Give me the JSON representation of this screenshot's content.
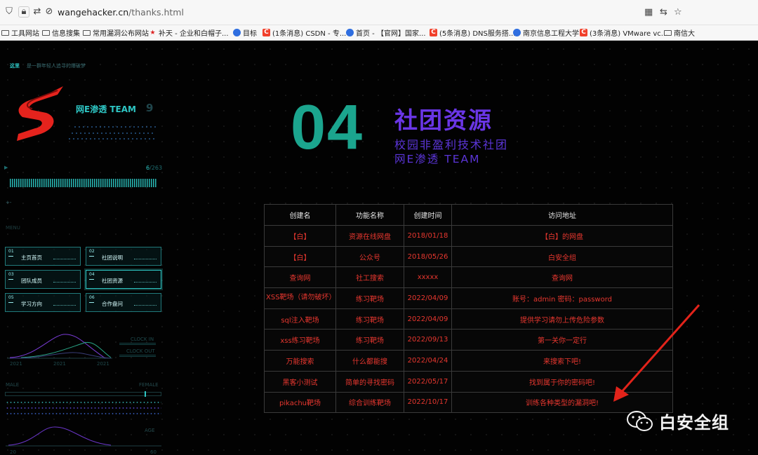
{
  "browser": {
    "url_domain": "wangehacker.cn",
    "url_path": "/thanks.html",
    "bookmarks": [
      {
        "label": "工具网站",
        "icon": "folder-icon"
      },
      {
        "label": "信息搜集",
        "icon": "folder-icon"
      },
      {
        "label": "常用漏洞公布网站",
        "icon": "folder-icon"
      },
      {
        "label": "补天 - 企业和白帽子...",
        "icon": "star-icon"
      },
      {
        "label": "目标",
        "icon": "globe-icon"
      },
      {
        "label": "(1条消息) CSDN - 专...",
        "icon": "csdn-icon"
      },
      {
        "label": "首页 - 【官网】国家...",
        "icon": "globe-icon"
      },
      {
        "label": "(5条消息) DNS服务搭...",
        "icon": "csdn-icon"
      },
      {
        "label": "南京信息工程大学",
        "icon": "globe-icon"
      },
      {
        "label": "(3条消息) VMware vc...",
        "icon": "csdn-icon"
      },
      {
        "label": "南信大",
        "icon": "folder-icon"
      }
    ]
  },
  "sidebar": {
    "top_here": "这里",
    "top_tagline": "是一群年轻人追寻的爆破梦",
    "brand_name": "网E渗透 TEAM",
    "brand_num": "9",
    "counter_current": "6",
    "counter_total": "/263",
    "menu_label": "MENU",
    "menu": [
      {
        "num": "01",
        "label": "主页首页"
      },
      {
        "num": "02",
        "label": "社团说明"
      },
      {
        "num": "03",
        "label": "团队成员"
      },
      {
        "num": "04",
        "label": "社团资源"
      },
      {
        "num": "05",
        "label": "学习方向"
      },
      {
        "num": "06",
        "label": "合作盘问"
      }
    ],
    "clock_in": "CLOCK IN",
    "clock_out": "CLOCK OUT",
    "years": [
      "2021",
      "2021",
      "2021"
    ],
    "male": "MALE",
    "female": "FEMALE",
    "age": "AGE",
    "age_ticks": [
      "20",
      "60"
    ]
  },
  "hero": {
    "number": "04",
    "title": "社团资源",
    "subtitle": "校园非盈利技术社团",
    "team": "网E渗透 TEAM"
  },
  "table": {
    "headers": [
      "创建名",
      "功能名称",
      "创建时间",
      "访问地址"
    ],
    "rows": [
      [
        "【白】",
        "资源在线网盘",
        "2018/01/18",
        "【白】的网盘"
      ],
      [
        "【白】",
        "公众号",
        "2018/05/26",
        "白安全组"
      ],
      [
        "查询网",
        "社工搜索",
        "xxxxx",
        "查询网"
      ],
      [
        "XSS靶场（请勿破坏）",
        "练习靶场",
        "2022/04/09",
        "账号：admin 密码：password"
      ],
      [
        "sql注入靶场",
        "练习靶场",
        "2022/04/09",
        "提供学习请勿上传危险参数"
      ],
      [
        "xss练习靶场",
        "练习靶场",
        "2022/09/13",
        "第一关你一定行"
      ],
      [
        "万能搜索",
        "什么都能搜",
        "2022/04/24",
        "来搜索下吧!"
      ],
      [
        "黑客小测试",
        "简单的寻找密码",
        "2022/05/17",
        "找到属于你的密码吧!"
      ],
      [
        "pikachu靶场",
        "综合训练靶场",
        "2022/10/17",
        "训练各种类型的漏洞吧!"
      ]
    ]
  },
  "watermark": {
    "text": "白安全组",
    "icon": "wechat-icon"
  },
  "colors": {
    "accent_teal": "#1ba58e",
    "accent_purple": "#6a36e6",
    "cell_red": "#e8372f"
  }
}
